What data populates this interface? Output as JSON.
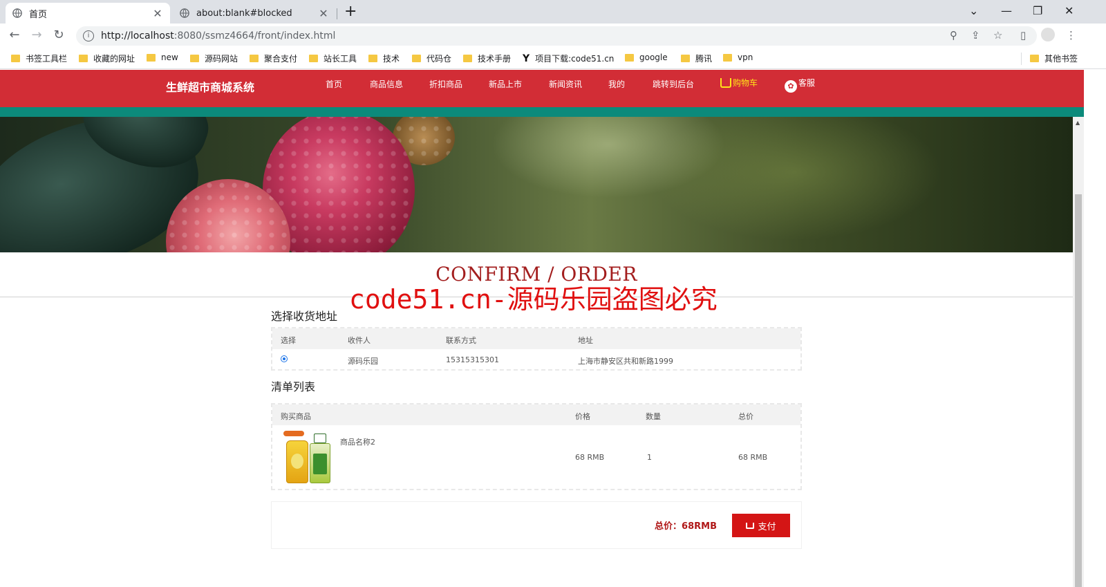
{
  "browser": {
    "tabs": [
      {
        "title": "首页",
        "active": true
      },
      {
        "title": "about:blank#blocked",
        "active": false
      }
    ],
    "url_host": "http://localhost",
    "url_rest": ":8080/ssmz4664/front/index.html",
    "bookmarks": [
      "书签工具栏",
      "收藏的网址",
      "new",
      "源码网站",
      "聚合支付",
      "站长工具",
      "技术",
      "代码仓",
      "技术手册",
      "项目下载:code51.cn",
      "google",
      "腾讯",
      "vpn"
    ],
    "other_bookmarks": "其他书签"
  },
  "site": {
    "title": "生鲜超市商城系统",
    "nav": [
      "首页",
      "商品信息",
      "折扣商品",
      "新品上市",
      "新闻资讯",
      "我的",
      "跳转到后台"
    ],
    "cart": "购物车",
    "service": "客服"
  },
  "page": {
    "heading": "CONFIRM / ORDER",
    "watermark": "code51.cn-源码乐园盗图必究"
  },
  "address": {
    "section_title": "选择收货地址",
    "headers": [
      "选择",
      "收件人",
      "联系方式",
      "地址"
    ],
    "rows": [
      {
        "recipient": "源码乐园",
        "phone": "15315315301",
        "address": "上海市静安区共和新路1999",
        "selected": true
      }
    ]
  },
  "items": {
    "section_title": "清单列表",
    "headers": [
      "购买商品",
      "价格",
      "数量",
      "总价"
    ],
    "rows": [
      {
        "name": "商品名称2",
        "price": "68 RMB",
        "qty": "1",
        "total": "68 RMB"
      }
    ]
  },
  "summary": {
    "total_label": "总价：68RMB",
    "pay_label": "支付"
  },
  "colors": {
    "header_red": "#d22d36",
    "teal": "#0c8a7b",
    "accent_red": "#d41515",
    "cart_yellow": "#ffe21a"
  }
}
